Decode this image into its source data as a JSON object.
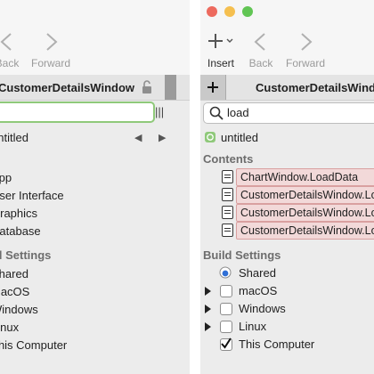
{
  "left": {
    "toolbar": {
      "back_label": "Back",
      "forward_label": "Forward"
    },
    "window_title": "CustomerDetailsWindow",
    "search_value": "",
    "project_row": "untitled",
    "items": [
      "App",
      "User Interface",
      "Graphics",
      "Database"
    ],
    "build_settings_header": "Build Settings",
    "build_items": [
      "Shared",
      "macOS",
      "Windows",
      "Linux",
      "This Computer"
    ]
  },
  "right": {
    "toolbar": {
      "insert_label": "Insert",
      "back_label": "Back",
      "forward_label": "Forward"
    },
    "window_title": "CustomerDetailsWindow",
    "search_value": "load",
    "project_row": "untitled",
    "contents_header": "Contents",
    "results": [
      "ChartWindow.LoadData",
      "CustomerDetailsWindow.LoadCustomer",
      "CustomerDetailsWindow.LoadDetails",
      "CustomerDetailsWindow.LoadOrders"
    ],
    "build_settings_header": "Build Settings",
    "build_items": [
      "Shared",
      "macOS",
      "Windows",
      "Linux",
      "This Computer"
    ]
  },
  "colors": {
    "accent_green": "#8fc97a",
    "result_highlight": "#f2d9d9",
    "traffic_red": "#ed6a5e",
    "traffic_yellow": "#f5bf4f",
    "traffic_green": "#61c554"
  },
  "icons": [
    "chevron-left-icon",
    "chevron-right-icon",
    "plus-icon",
    "lock-icon",
    "search-icon",
    "project-icon",
    "doc-icon",
    "radio-icon",
    "checkmark-icon"
  ]
}
